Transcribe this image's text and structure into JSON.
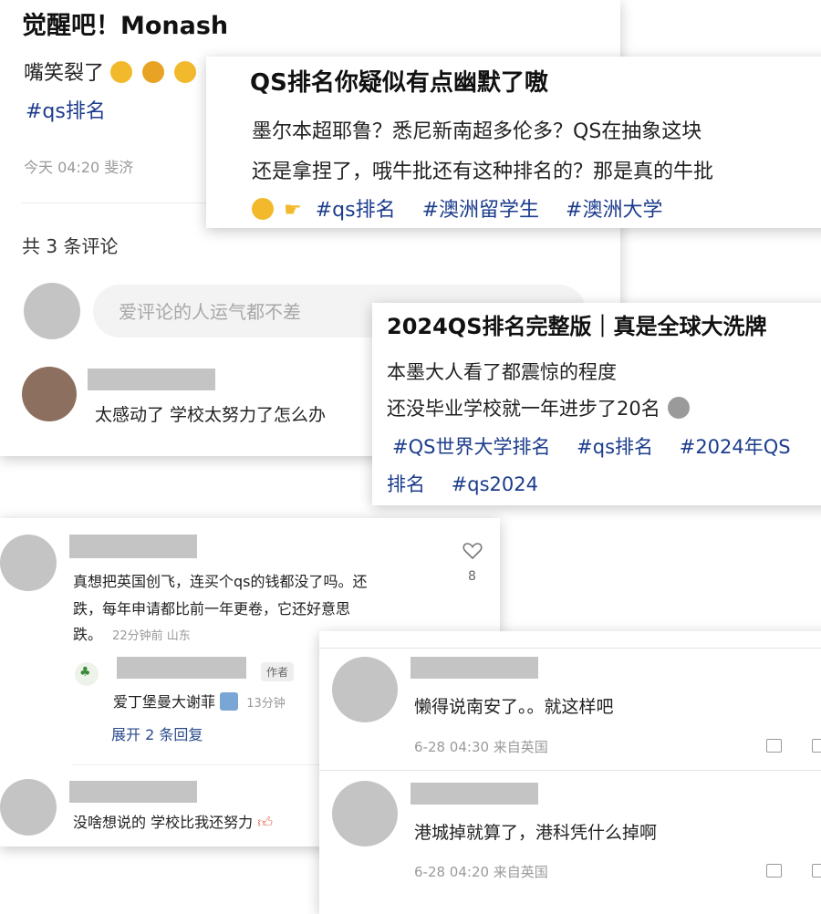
{
  "post1": {
    "title": "觉醒吧！Monash",
    "body": "嘴笑裂了",
    "tag": "#qs排名",
    "meta": "今天 04:20 斐济",
    "comment_count": "共 3 条评论",
    "input_placeholder": "爱评论的人运气都不差",
    "comment": "太感动了 学校太努力了怎么办"
  },
  "post2": {
    "title": "QS排名你疑似有点幽默了嗷",
    "line1": "墨尔本超耶鲁？悉尼新南超多伦多？QS在抽象这块",
    "line2": "还是拿捏了，哦牛批还有这种排名的？那是真的牛批",
    "tags": [
      "#qs排名",
      "#澳洲留学生",
      "#澳洲大学"
    ]
  },
  "post3": {
    "title": "2024QS排名完整版｜真是全球大洗牌",
    "line1": "本墨大人看了都震惊的程度",
    "line2": "还没毕业学校就一年进步了20名",
    "tags_row1": [
      "#QS世界大学排名",
      "#qs排名",
      "#2024年QS"
    ],
    "tags_row2": [
      "排名",
      "#qs2024"
    ]
  },
  "thread1": {
    "comment_l1": "真想把英国创飞，连买个qs的钱都没了吗。还",
    "comment_l2": "跌，每年申请都比前一年更卷，它还好意思",
    "comment_l3": "跌。",
    "comment_meta": "22分钟前 山东",
    "likes": "8",
    "author_badge": "作者",
    "reply_text": "爱丁堡曼大谢菲",
    "reply_meta": "13分钟",
    "expand": "展开 2 条回复",
    "comment2": "没啥想说的 学校比我还努力"
  },
  "thread2": {
    "comment1": "懒得说南安了。。就这样吧",
    "meta1": "6-28 04:30 来自英国",
    "comment2": "港城掉就算了，港科凭什么掉啊",
    "meta2": "6-28 04:20 来自英国"
  },
  "colors": {
    "tag": "#1c3c8c",
    "redacted": "#c4c4c4",
    "emoji": "#f2b92c"
  }
}
